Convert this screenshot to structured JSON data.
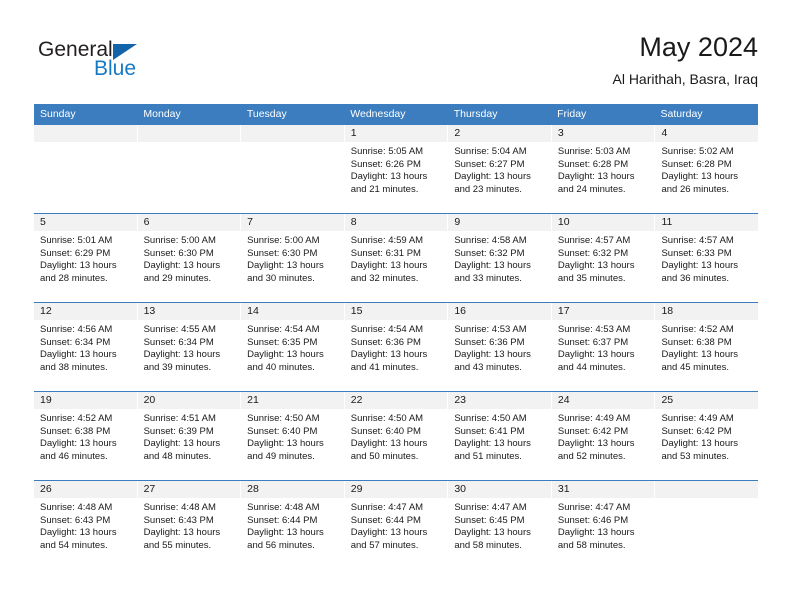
{
  "brand": {
    "word_one": "General",
    "word_two": "Blue",
    "accent_color": "#1779c4",
    "triangle_color": "#1464aa",
    "logo_icon": "triangle-icon"
  },
  "header": {
    "title": "May 2024",
    "subtitle": "Al Harithah, Basra, Iraq"
  },
  "theme": {
    "header_bg": "#3b7dbf",
    "daynum_bg": "#f2f2f2",
    "cell_bg": "#ffffff",
    "text": "#1a1a1a"
  },
  "weekdays": [
    "Sunday",
    "Monday",
    "Tuesday",
    "Wednesday",
    "Thursday",
    "Friday",
    "Saturday"
  ],
  "weeks": [
    [
      {
        "day": "",
        "empty": true,
        "l1": "",
        "l2": "",
        "l3": "",
        "l4": ""
      },
      {
        "day": "",
        "empty": true,
        "l1": "",
        "l2": "",
        "l3": "",
        "l4": ""
      },
      {
        "day": "",
        "empty": true,
        "l1": "",
        "l2": "",
        "l3": "",
        "l4": ""
      },
      {
        "day": "1",
        "empty": false,
        "l1": "Sunrise: 5:05 AM",
        "l2": "Sunset: 6:26 PM",
        "l3": "Daylight: 13 hours",
        "l4": "and 21 minutes."
      },
      {
        "day": "2",
        "empty": false,
        "l1": "Sunrise: 5:04 AM",
        "l2": "Sunset: 6:27 PM",
        "l3": "Daylight: 13 hours",
        "l4": "and 23 minutes."
      },
      {
        "day": "3",
        "empty": false,
        "l1": "Sunrise: 5:03 AM",
        "l2": "Sunset: 6:28 PM",
        "l3": "Daylight: 13 hours",
        "l4": "and 24 minutes."
      },
      {
        "day": "4",
        "empty": false,
        "l1": "Sunrise: 5:02 AM",
        "l2": "Sunset: 6:28 PM",
        "l3": "Daylight: 13 hours",
        "l4": "and 26 minutes."
      }
    ],
    [
      {
        "day": "5",
        "empty": false,
        "l1": "Sunrise: 5:01 AM",
        "l2": "Sunset: 6:29 PM",
        "l3": "Daylight: 13 hours",
        "l4": "and 28 minutes."
      },
      {
        "day": "6",
        "empty": false,
        "l1": "Sunrise: 5:00 AM",
        "l2": "Sunset: 6:30 PM",
        "l3": "Daylight: 13 hours",
        "l4": "and 29 minutes."
      },
      {
        "day": "7",
        "empty": false,
        "l1": "Sunrise: 5:00 AM",
        "l2": "Sunset: 6:30 PM",
        "l3": "Daylight: 13 hours",
        "l4": "and 30 minutes."
      },
      {
        "day": "8",
        "empty": false,
        "l1": "Sunrise: 4:59 AM",
        "l2": "Sunset: 6:31 PM",
        "l3": "Daylight: 13 hours",
        "l4": "and 32 minutes."
      },
      {
        "day": "9",
        "empty": false,
        "l1": "Sunrise: 4:58 AM",
        "l2": "Sunset: 6:32 PM",
        "l3": "Daylight: 13 hours",
        "l4": "and 33 minutes."
      },
      {
        "day": "10",
        "empty": false,
        "l1": "Sunrise: 4:57 AM",
        "l2": "Sunset: 6:32 PM",
        "l3": "Daylight: 13 hours",
        "l4": "and 35 minutes."
      },
      {
        "day": "11",
        "empty": false,
        "l1": "Sunrise: 4:57 AM",
        "l2": "Sunset: 6:33 PM",
        "l3": "Daylight: 13 hours",
        "l4": "and 36 minutes."
      }
    ],
    [
      {
        "day": "12",
        "empty": false,
        "l1": "Sunrise: 4:56 AM",
        "l2": "Sunset: 6:34 PM",
        "l3": "Daylight: 13 hours",
        "l4": "and 38 minutes."
      },
      {
        "day": "13",
        "empty": false,
        "l1": "Sunrise: 4:55 AM",
        "l2": "Sunset: 6:34 PM",
        "l3": "Daylight: 13 hours",
        "l4": "and 39 minutes."
      },
      {
        "day": "14",
        "empty": false,
        "l1": "Sunrise: 4:54 AM",
        "l2": "Sunset: 6:35 PM",
        "l3": "Daylight: 13 hours",
        "l4": "and 40 minutes."
      },
      {
        "day": "15",
        "empty": false,
        "l1": "Sunrise: 4:54 AM",
        "l2": "Sunset: 6:36 PM",
        "l3": "Daylight: 13 hours",
        "l4": "and 41 minutes."
      },
      {
        "day": "16",
        "empty": false,
        "l1": "Sunrise: 4:53 AM",
        "l2": "Sunset: 6:36 PM",
        "l3": "Daylight: 13 hours",
        "l4": "and 43 minutes."
      },
      {
        "day": "17",
        "empty": false,
        "l1": "Sunrise: 4:53 AM",
        "l2": "Sunset: 6:37 PM",
        "l3": "Daylight: 13 hours",
        "l4": "and 44 minutes."
      },
      {
        "day": "18",
        "empty": false,
        "l1": "Sunrise: 4:52 AM",
        "l2": "Sunset: 6:38 PM",
        "l3": "Daylight: 13 hours",
        "l4": "and 45 minutes."
      }
    ],
    [
      {
        "day": "19",
        "empty": false,
        "l1": "Sunrise: 4:52 AM",
        "l2": "Sunset: 6:38 PM",
        "l3": "Daylight: 13 hours",
        "l4": "and 46 minutes."
      },
      {
        "day": "20",
        "empty": false,
        "l1": "Sunrise: 4:51 AM",
        "l2": "Sunset: 6:39 PM",
        "l3": "Daylight: 13 hours",
        "l4": "and 48 minutes."
      },
      {
        "day": "21",
        "empty": false,
        "l1": "Sunrise: 4:50 AM",
        "l2": "Sunset: 6:40 PM",
        "l3": "Daylight: 13 hours",
        "l4": "and 49 minutes."
      },
      {
        "day": "22",
        "empty": false,
        "l1": "Sunrise: 4:50 AM",
        "l2": "Sunset: 6:40 PM",
        "l3": "Daylight: 13 hours",
        "l4": "and 50 minutes."
      },
      {
        "day": "23",
        "empty": false,
        "l1": "Sunrise: 4:50 AM",
        "l2": "Sunset: 6:41 PM",
        "l3": "Daylight: 13 hours",
        "l4": "and 51 minutes."
      },
      {
        "day": "24",
        "empty": false,
        "l1": "Sunrise: 4:49 AM",
        "l2": "Sunset: 6:42 PM",
        "l3": "Daylight: 13 hours",
        "l4": "and 52 minutes."
      },
      {
        "day": "25",
        "empty": false,
        "l1": "Sunrise: 4:49 AM",
        "l2": "Sunset: 6:42 PM",
        "l3": "Daylight: 13 hours",
        "l4": "and 53 minutes."
      }
    ],
    [
      {
        "day": "26",
        "empty": false,
        "l1": "Sunrise: 4:48 AM",
        "l2": "Sunset: 6:43 PM",
        "l3": "Daylight: 13 hours",
        "l4": "and 54 minutes."
      },
      {
        "day": "27",
        "empty": false,
        "l1": "Sunrise: 4:48 AM",
        "l2": "Sunset: 6:43 PM",
        "l3": "Daylight: 13 hours",
        "l4": "and 55 minutes."
      },
      {
        "day": "28",
        "empty": false,
        "l1": "Sunrise: 4:48 AM",
        "l2": "Sunset: 6:44 PM",
        "l3": "Daylight: 13 hours",
        "l4": "and 56 minutes."
      },
      {
        "day": "29",
        "empty": false,
        "l1": "Sunrise: 4:47 AM",
        "l2": "Sunset: 6:44 PM",
        "l3": "Daylight: 13 hours",
        "l4": "and 57 minutes."
      },
      {
        "day": "30",
        "empty": false,
        "l1": "Sunrise: 4:47 AM",
        "l2": "Sunset: 6:45 PM",
        "l3": "Daylight: 13 hours",
        "l4": "and 58 minutes."
      },
      {
        "day": "31",
        "empty": false,
        "l1": "Sunrise: 4:47 AM",
        "l2": "Sunset: 6:46 PM",
        "l3": "Daylight: 13 hours",
        "l4": "and 58 minutes."
      },
      {
        "day": "",
        "empty": true,
        "l1": "",
        "l2": "",
        "l3": "",
        "l4": ""
      }
    ]
  ]
}
